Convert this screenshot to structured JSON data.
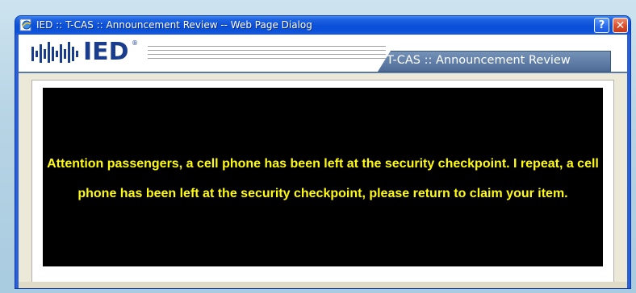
{
  "window": {
    "title": "IED :: T-CAS :: Announcement Review -- Web Page Dialog",
    "help_label": "?",
    "close_label": "✕",
    "icon": "ie-page-icon"
  },
  "header": {
    "logo_text": "IED",
    "logo_mark": "®",
    "tab_label": "T-CAS :: Announcement Review"
  },
  "announcement": {
    "text": "Attention passengers, a cell phone has been left at the security checkpoint. I repeat, a cell phone has been left at the security checkpoint, please return to claim your item."
  },
  "colors": {
    "announcement_text": "#fffb10",
    "announcement_background": "#000000",
    "tab_background": "#5a7aa6",
    "titlebar": "#0a4fd8",
    "logo": "#1a3c8c"
  }
}
